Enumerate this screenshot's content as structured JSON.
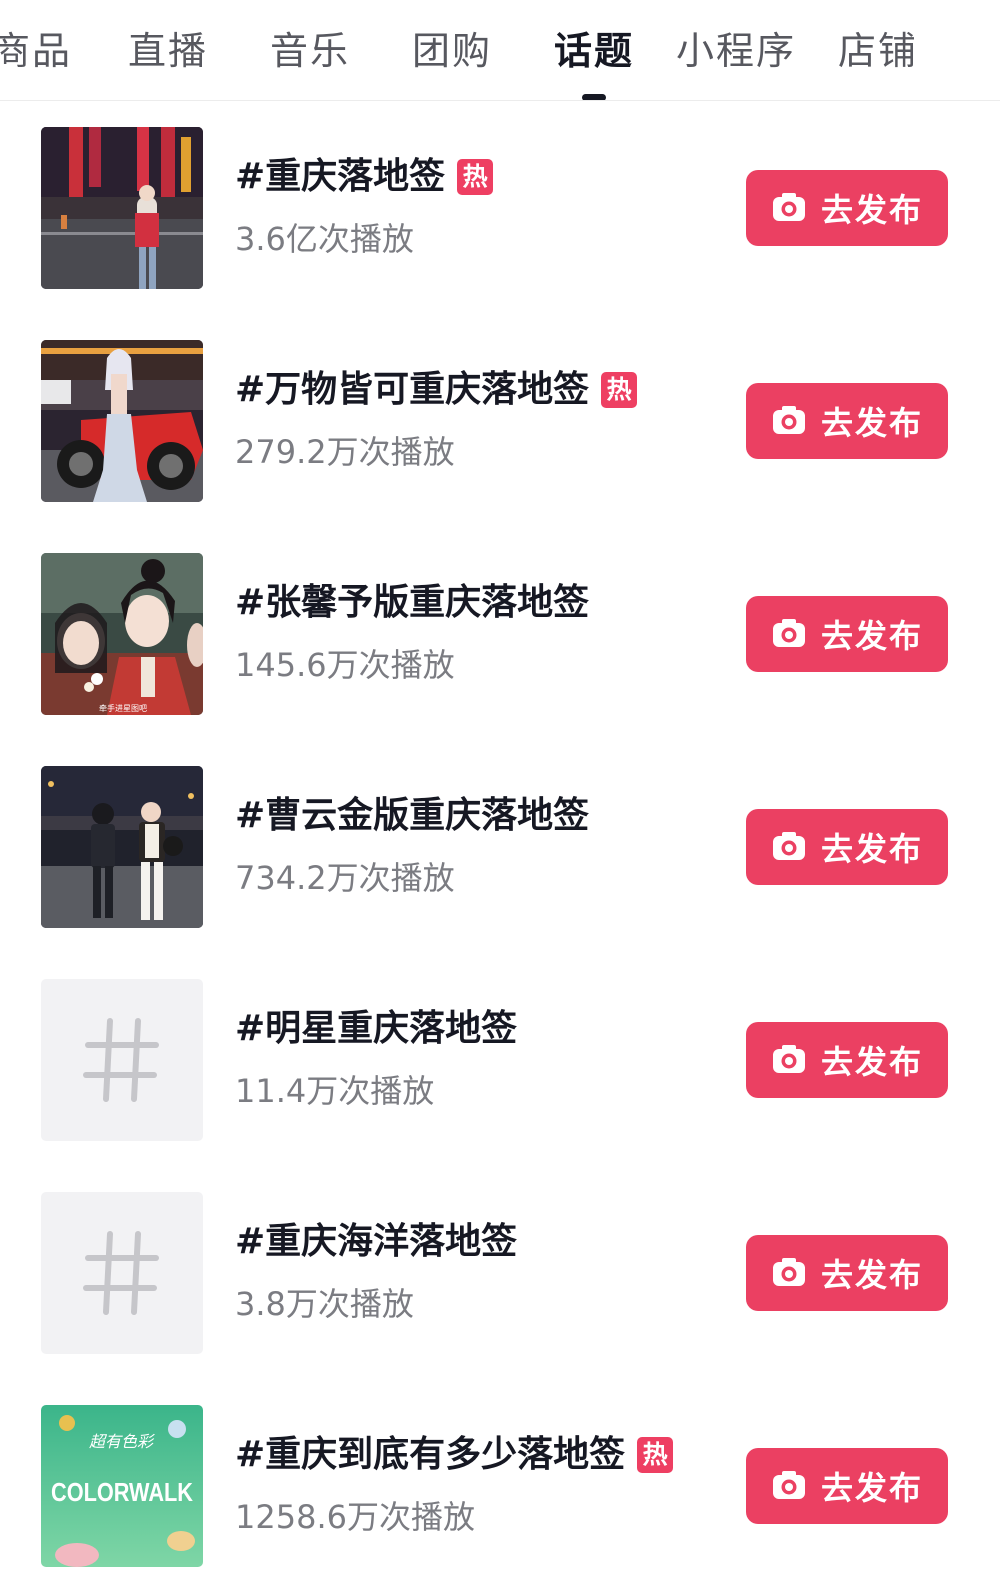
{
  "tabs": [
    {
      "label": "商品",
      "active": false
    },
    {
      "label": "直播",
      "active": false
    },
    {
      "label": "音乐",
      "active": false
    },
    {
      "label": "团购",
      "active": false
    },
    {
      "label": "话题",
      "active": true
    },
    {
      "label": "小程序",
      "active": false
    },
    {
      "label": "店铺",
      "active": false
    }
  ],
  "hot_label": "热",
  "publish_label": "去发布",
  "colors": {
    "accent": "#eb4062",
    "hot_badge": "#ee3f62",
    "text_primary": "#161823",
    "text_secondary": "#7b7c82"
  },
  "topics": [
    {
      "title": "#重庆落地签",
      "hot": true,
      "plays": "3.6亿次播放",
      "thumbnail": "night-street-photo"
    },
    {
      "title": "#万物皆可重庆落地签",
      "hot": true,
      "plays": "279.2万次播放",
      "thumbnail": "mermaid-motorcycle-photo"
    },
    {
      "title": "#张馨予版重庆落地签",
      "hot": false,
      "plays": "145.6万次播放",
      "thumbnail": "costume-drama-photo",
      "thumbnail_caption": "牵手进星图吧"
    },
    {
      "title": "#曹云金版重庆落地签",
      "hot": false,
      "plays": "734.2万次播放",
      "thumbnail": "night-walk-photo"
    },
    {
      "title": "#明星重庆落地签",
      "hot": false,
      "plays": "11.4万次播放",
      "thumbnail": "hashtag-placeholder-icon"
    },
    {
      "title": "#重庆海洋落地签",
      "hot": false,
      "plays": "3.8万次播放",
      "thumbnail": "hashtag-placeholder-icon"
    },
    {
      "title": "#重庆到底有多少落地签",
      "hot": true,
      "plays": "1258.6万次播放",
      "thumbnail": "colorwalk-poster",
      "thumbnail_text": "COLORWALK",
      "thumbnail_subtext": "超有色彩"
    }
  ]
}
